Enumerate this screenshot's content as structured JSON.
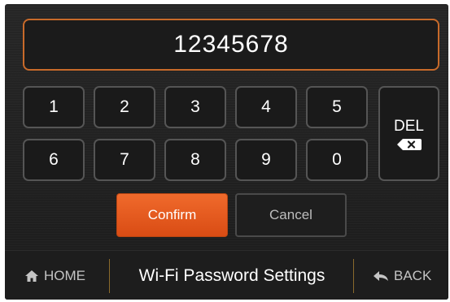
{
  "password_field": {
    "value": "12345678"
  },
  "keypad": {
    "keys": [
      "1",
      "2",
      "3",
      "4",
      "5",
      "6",
      "7",
      "8",
      "9",
      "0"
    ],
    "delete_label": "DEL"
  },
  "actions": {
    "confirm_label": "Confirm",
    "cancel_label": "Cancel"
  },
  "bottom_bar": {
    "home_label": "HOME",
    "title": "Wi-Fi Password Settings",
    "back_label": "BACK"
  },
  "colors": {
    "accent": "#E85C20",
    "field_border": "#C86A2A",
    "background": "#1E1E1E"
  },
  "icons": {
    "home": "home-icon",
    "back": "back-arrow-icon",
    "delete": "backspace-icon"
  }
}
